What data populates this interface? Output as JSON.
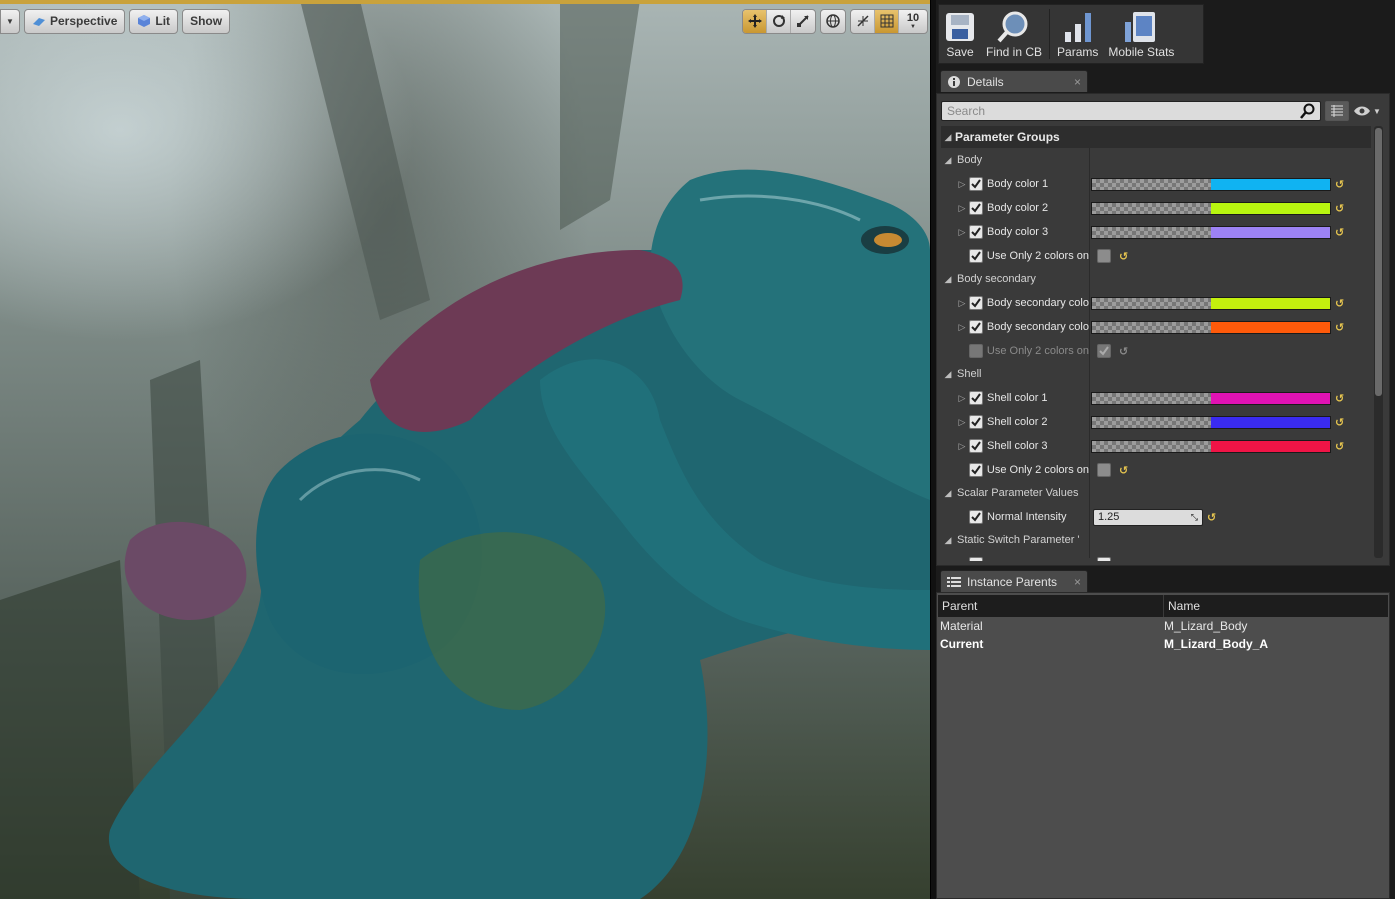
{
  "viewport": {
    "toolbar": {
      "perspective_label": "Perspective",
      "lit_label": "Lit",
      "show_label": "Show",
      "grid_snap_value": "10"
    },
    "accent_color": "#c9a23c"
  },
  "main_toolbar": {
    "buttons": [
      {
        "label": "Save",
        "icon": "save-icon"
      },
      {
        "label": "Find in CB",
        "icon": "find-in-content-browser-icon"
      },
      {
        "label": "Params",
        "icon": "params-icon"
      },
      {
        "label": "Mobile Stats",
        "icon": "mobile-stats-icon"
      }
    ]
  },
  "details": {
    "tab_label": "Details",
    "search_placeholder": "Search",
    "header": "Parameter Groups",
    "groups": {
      "body": {
        "label": "Body",
        "params": [
          {
            "label": "Body color 1",
            "color": "#10b3f2",
            "enabled": true
          },
          {
            "label": "Body color 2",
            "color": "#b8f510",
            "enabled": true
          },
          {
            "label": "Body color 3",
            "color": "#9d82f5",
            "enabled": true
          },
          {
            "label": "Use Only 2 colors on",
            "value": false,
            "enabled": true
          }
        ]
      },
      "body_secondary": {
        "label": "Body secondary",
        "params": [
          {
            "label": "Body secondary colo",
            "color": "#c3f00e",
            "enabled": true
          },
          {
            "label": "Body secondary colo",
            "color": "#ff5a0a",
            "enabled": true
          },
          {
            "label": "Use Only 2 colors on",
            "value": true,
            "enabled": false
          }
        ]
      },
      "shell": {
        "label": "Shell",
        "params": [
          {
            "label": "Shell color 1",
            "color": "#e012b3",
            "enabled": true
          },
          {
            "label": "Shell color 2",
            "color": "#3a2bf0",
            "enabled": true
          },
          {
            "label": "Shell color 3",
            "color": "#f01446",
            "enabled": true
          },
          {
            "label": "Use Only 2 colors on",
            "value": false,
            "enabled": true
          }
        ]
      },
      "scalar": {
        "label": "Scalar Parameter Values",
        "params": [
          {
            "label": "Normal Intensity",
            "value": "1.25",
            "enabled": true
          }
        ]
      },
      "static_switch": {
        "label": "Static Switch Parameter '"
      }
    }
  },
  "instance_parents": {
    "tab_label": "Instance Parents",
    "columns": [
      "Parent",
      "Name"
    ],
    "rows": [
      {
        "parent": "Material",
        "name": "M_Lizard_Body"
      },
      {
        "parent": "Current",
        "name": "M_Lizard_Body_A"
      }
    ]
  }
}
